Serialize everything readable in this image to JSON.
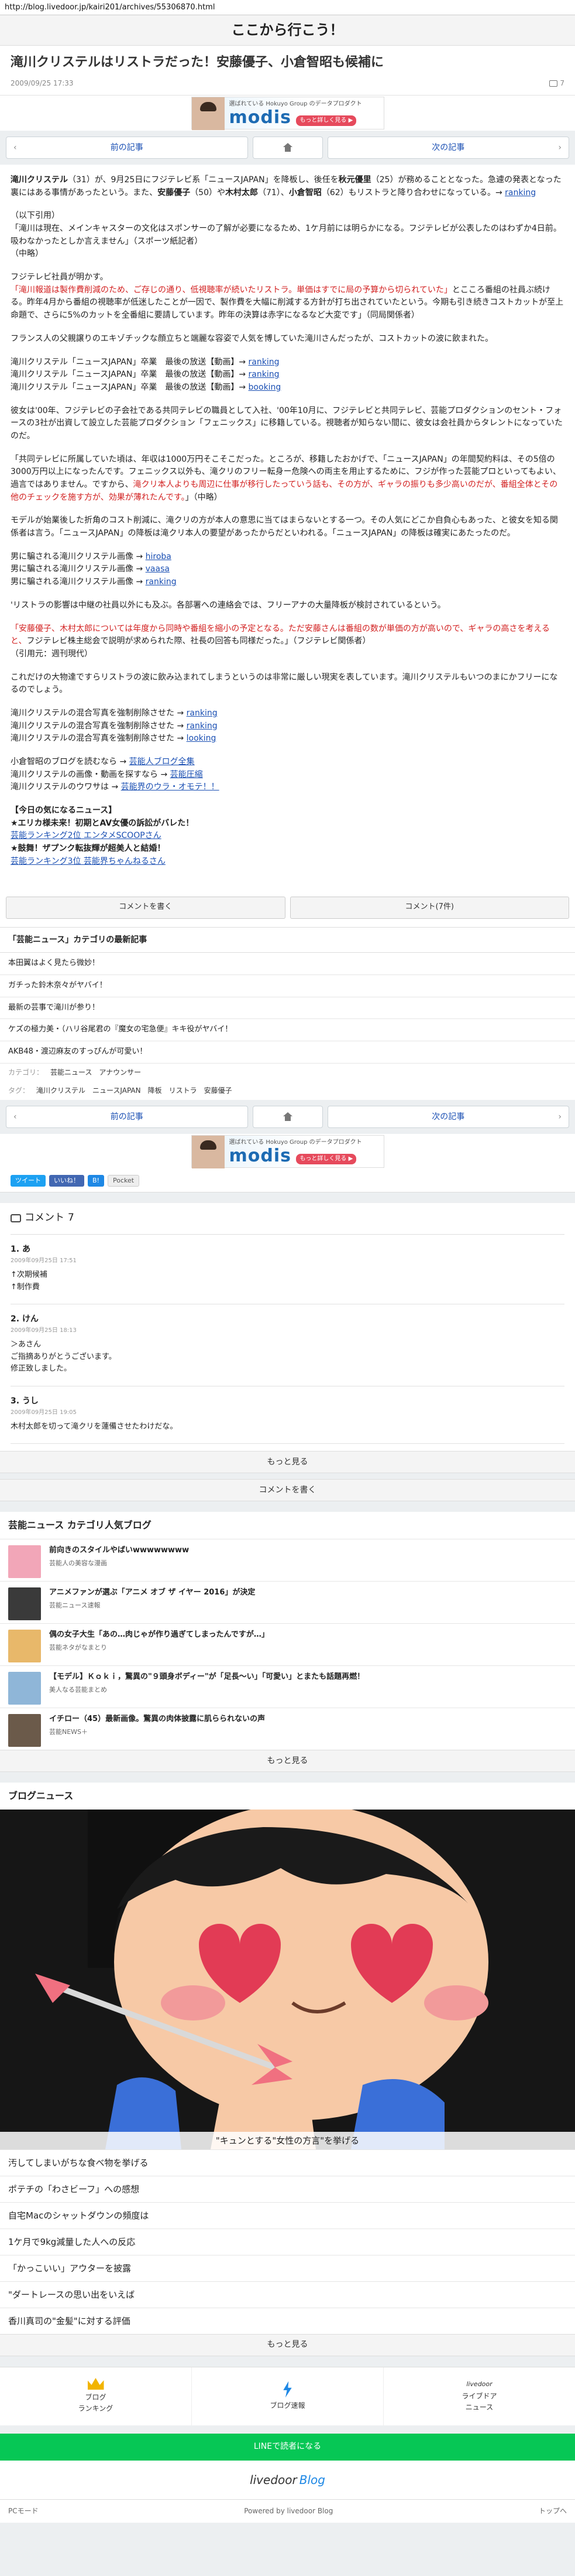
{
  "url": "http://blog.livedoor.jp/kairi201/archives/55306870.html",
  "site": {
    "title": "ここから行こう！"
  },
  "article": {
    "title": "滝川クリステルはリストラだった！安藤優子、小倉智昭も候補に",
    "date": "2009/09/25 17:33",
    "comment_count": "7"
  },
  "ad": {
    "tag": "選ばれている Hokuyo Group のデータプロダクト",
    "logo": "modis",
    "cta": "もっと詳しく見る ▶"
  },
  "pager": {
    "prev": "前の記事",
    "next": "次の記事"
  },
  "body": {
    "p1a": "滝川クリステル",
    "p1b": "（31）が、9月25日にフジテレビ系「ニュースJAPAN」を降板し、後任を",
    "p1c": "秋元優里",
    "p1d": "（25）が務めることとなった。急遽の発表となった裏にはある事情があったという。また、",
    "p1e": "安藤優子",
    "p1f": "（50）や",
    "p1g": "木村太郎",
    "p1h": "（71）、",
    "p1i": "小倉智昭",
    "p1j": "（62）もリストラと降り合わせになっている。→ ",
    "p1link": "ranking",
    "p2a": "（以下引用）",
    "p2b": "「滝川は現在、メインキャスターの文化はスポンサーの了解が必要になるため、1ケ月前には明らかになる。フジテレビが公表したのはわずか4日前。吸わなかったとしか言えません」（スポーツ紙記者）",
    "p2c": "（中略）",
    "p3": "フジテレビ社員が明かす。",
    "p4red": "「滝川報道は製作費削減のため、ご存じの通り、低視聴率が続いたリストラ。単価はすでに局の予算から切られていた」",
    "p4rest": "とこころ番組の社員ぶ続ける。昨年4月から番組の視聴率が低迷したことが一因で、製作費を大幅に削減する方針が打ち出されていたという。今期も引き続きコストカットが至上命題で、さらに5%のカットを全番組に要請しています。昨年の決算は赤字になるなど大変です」（同局関係者）",
    "p5": "フランス人の父親譲りのエキゾチックな顔立ちと端麗な容姿で人気を博していた滝川さんだったが、コストカットの波に飲まれた。",
    "links1": [
      {
        "text": "滝川クリステル「ニュースJAPAN」卒業　最後の放送【動画】→ ",
        "link": "ranking"
      },
      {
        "text": "滝川クリステル「ニュースJAPAN」卒業　最後の放送【動画】→ ",
        "link": "ranking"
      },
      {
        "text": "滝川クリステル「ニュースJAPAN」卒業　最後の放送【動画】→ ",
        "link": "booking"
      }
    ],
    "p6": "彼女は'00年、フジテレビの子会社である共同テレビの職員として入社、'00年10月に、フジテレビと共同テレビ、芸能プロダクションのセント・フォースの3社が出資して設立した芸能プロダクション「フェニックス」に移籍している。視聴者が知らない間に、彼女は会社員からタレントになっていたのだ。",
    "p7a": "「共同テレビに所属していた頃は、年収は1000万円そこそこだった。ところが、移籍したおかげで、「ニュースJAPAN」の年間契約料は、その5倍の3000万円以上になったんです。フェニックス以外も、滝クリのフリー転身ー危険への両主を用止するために、フジが作った芸能プロといってもよい、過言ではありません。ですから、",
    "p7red": "滝クリ本人よりも周辺に仕事が移行したっていう話も、その方が、ギャラの振りも多少高いのだが、番組全体とその他のチェックを施す方が、効果が薄れたんです。",
    "p7b": "」（中略）",
    "p8": "モデルが始業後した折角のコスト削減に、滝クリの方が本人の意思に当てはまらないとする一つ。その人気にどこか自負心もあった、と彼女を知る関係者は言う。「ニュースJAPAN」の降板は滝クリ本人の要望があったからだといわれる。「ニュースJAPAN」の降板は確実にあたったのだ。",
    "links2": [
      {
        "text": "男に騙される滝川クリステル画像 → ",
        "link": "hiroba"
      },
      {
        "text": "男に騙される滝川クリステル画像 → ",
        "link": "vaasa"
      },
      {
        "text": "男に騙される滝川クリステル画像 → ",
        "link": "ranking"
      }
    ],
    "p9": "'リストラの影響は中継の社員以外にも及ぶ。各部署への連絡会では、フリーアナの大量降板が検討されているという。",
    "p10red": "「安藤優子、木村太郎については年度から同時や番組を縮小の予定となる。ただ安藤さんは番組の数が単価の方が高いので、ギャラの高さを考えると、",
    "p10a": "フジテレビ株主総会で説明が求められた際、社長の回答も同様だった。",
    "p10b": "」（フジテレビ関係者）",
    "p10c": "（引用元：週刊現代）",
    "p11": "これだけの大物達ですらリストラの波に飲み込まれてしまうというのは非常に厳しい現実を表しています。滝川クリステルもいつのまにかフリーになるのでしょう。",
    "links3": [
      {
        "text": "滝川クリステルの混合写真を強制削除させた → ",
        "link": "ranking"
      },
      {
        "text": "滝川クリステルの混合写真を強制削除させた → ",
        "link": "ranking"
      },
      {
        "text": "滝川クリステルの混合写真を強制削除させた → ",
        "link": "looking"
      }
    ],
    "links4": [
      {
        "text": "小倉智昭のブログを読むなら → ",
        "link": "芸能人ブログ全集"
      },
      {
        "text": "滝川クリステルの画像・動画を探すなら → ",
        "link": "芸能圧縮"
      },
      {
        "text": "滝川クリステルのウワサは → ",
        "link": "芸能界のウラ・オモテ！！"
      }
    ],
    "pickup_head": "【今日の気になるニュース】",
    "pickup": [
      "★エリカ様未来！初期とAV女優の訴訟がバレた！",
      "芸能ランキング2位 エンタメSCOOPさん",
      "★鼓舞！ザプンク転抜輝が超美人と結婚！",
      "芸能ランキング3位 芸能界ちゃんねるさん"
    ]
  },
  "actions": {
    "write": "コメントを書く",
    "count": "コメント(7件)"
  },
  "category": {
    "head": "「芸能ニュース」カテゴリの最新記事",
    "items": [
      "本田翼はよく見たら微妙！",
      "ガチった鈴木奈々がヤバイ！",
      "最新の芸事で滝川が参り！",
      "ケズの極力美・（ハリ谷尾君の『魔女の宅急便』キキ役がヤバイ！",
      "AKB48・渡辺麻友のすっぴんが可愛い！"
    ],
    "cat_label": "カテゴリ：",
    "cat_value": "芸能ニュース　アナウンサー",
    "tag_label": "タグ：",
    "tag_value": "滝川クリステル　ニュースJAPAN　降板　リストラ　安藤優子"
  },
  "share": {
    "twitter": "ツイート",
    "facebook": "いいね！",
    "hatena": "B!",
    "pocket": "Pocket"
  },
  "comments": {
    "title": "コメント",
    "count": "7",
    "list": [
      {
        "num": "1.",
        "name": "あ",
        "date": "2009年09月25日 17:51",
        "lines": [
          "↑次期候補",
          "↑制作費"
        ]
      },
      {
        "num": "2.",
        "name": "けん",
        "date": "2009年09月25日 18:13",
        "lines": [
          "＞あさん",
          "ご指摘ありがとうございます。",
          "修正致しました。"
        ]
      },
      {
        "num": "3.",
        "name": "うし",
        "date": "2009年09月25日 19:05",
        "lines": [
          "木村太郎を切って滝クリを蓮備させたわけだな。"
        ]
      }
    ],
    "more": "もっと見る",
    "write": "コメントを書く"
  },
  "ranking": {
    "head": "芸能ニュース カテゴリ人気ブログ",
    "items": [
      {
        "title": "前向きのスタイルやばいwwwwwwww",
        "src": "芸能人の美容な漫画"
      },
      {
        "title": "アニメファンが選ぶ「アニメ オブ ザ イヤー 2016」が決定",
        "src": "芸能ニュース速報"
      },
      {
        "title": "偶の女子大生「あの…肉じゃが作り過ぎてしまったんですが…」",
        "src": "芸能ネタがなまとり"
      },
      {
        "title": "【モデル】Ｋｏｋｉ，驚異の\"９頭身ボディー\"が「足長〜い」「可愛い」とまたも話題再燃！",
        "src": "美人なる芸能まとめ"
      },
      {
        "title": "イチロー（45）最新画像。驚異の肉体披露に肌らられないの声",
        "src": "芸能NEWS＋"
      }
    ],
    "more": "もっと見る"
  },
  "news": {
    "head": "ブログニュース",
    "caption": "\"キュンとする\"女性の方言\"を挙げる",
    "items": [
      "汚してしまいがちな食べ物を挙げる",
      "ポテチの「わさビーフ」への感想",
      "自宅Macのシャットダウンの頻度は",
      "1ケ月で9kg減量した人への反応",
      "「かっこいい」アウターを披露",
      "\"ダートレースの思い出をいえば",
      "香川真司の\"金髪\"に対する評価"
    ],
    "more": "もっと見る"
  },
  "footer": {
    "rank": "ブログ\nランキング",
    "news": "ブログ速報",
    "ld_top": "livedoor",
    "ld_sub": "ライブドア\nニュース",
    "line": "LINEで読者になる",
    "brand_a": "livedoor",
    "brand_b": "Blog",
    "pc": "PCモード",
    "powered": "Powered by livedoor Blog",
    "top": "トップへ"
  }
}
